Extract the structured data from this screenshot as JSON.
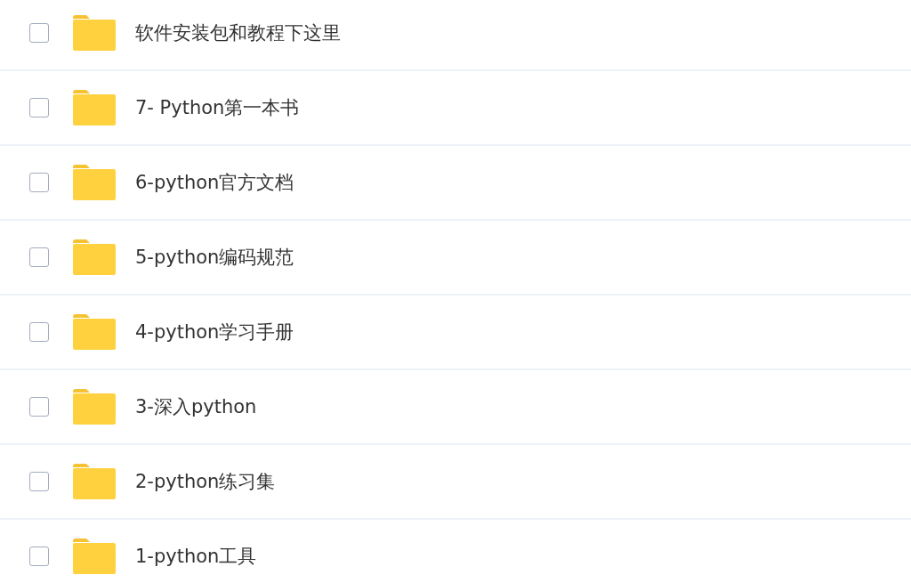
{
  "files": [
    {
      "name": "软件安装包和教程下这里",
      "checked": false
    },
    {
      "name": "7- Python第一本书",
      "checked": false
    },
    {
      "name": "6-python官方文档",
      "checked": false
    },
    {
      "name": "5-python编码规范",
      "checked": false
    },
    {
      "name": "4-python学习手册",
      "checked": false
    },
    {
      "name": "3-深入python",
      "checked": false
    },
    {
      "name": "2-python练习集",
      "checked": false
    },
    {
      "name": "1-python工具",
      "checked": false
    }
  ]
}
